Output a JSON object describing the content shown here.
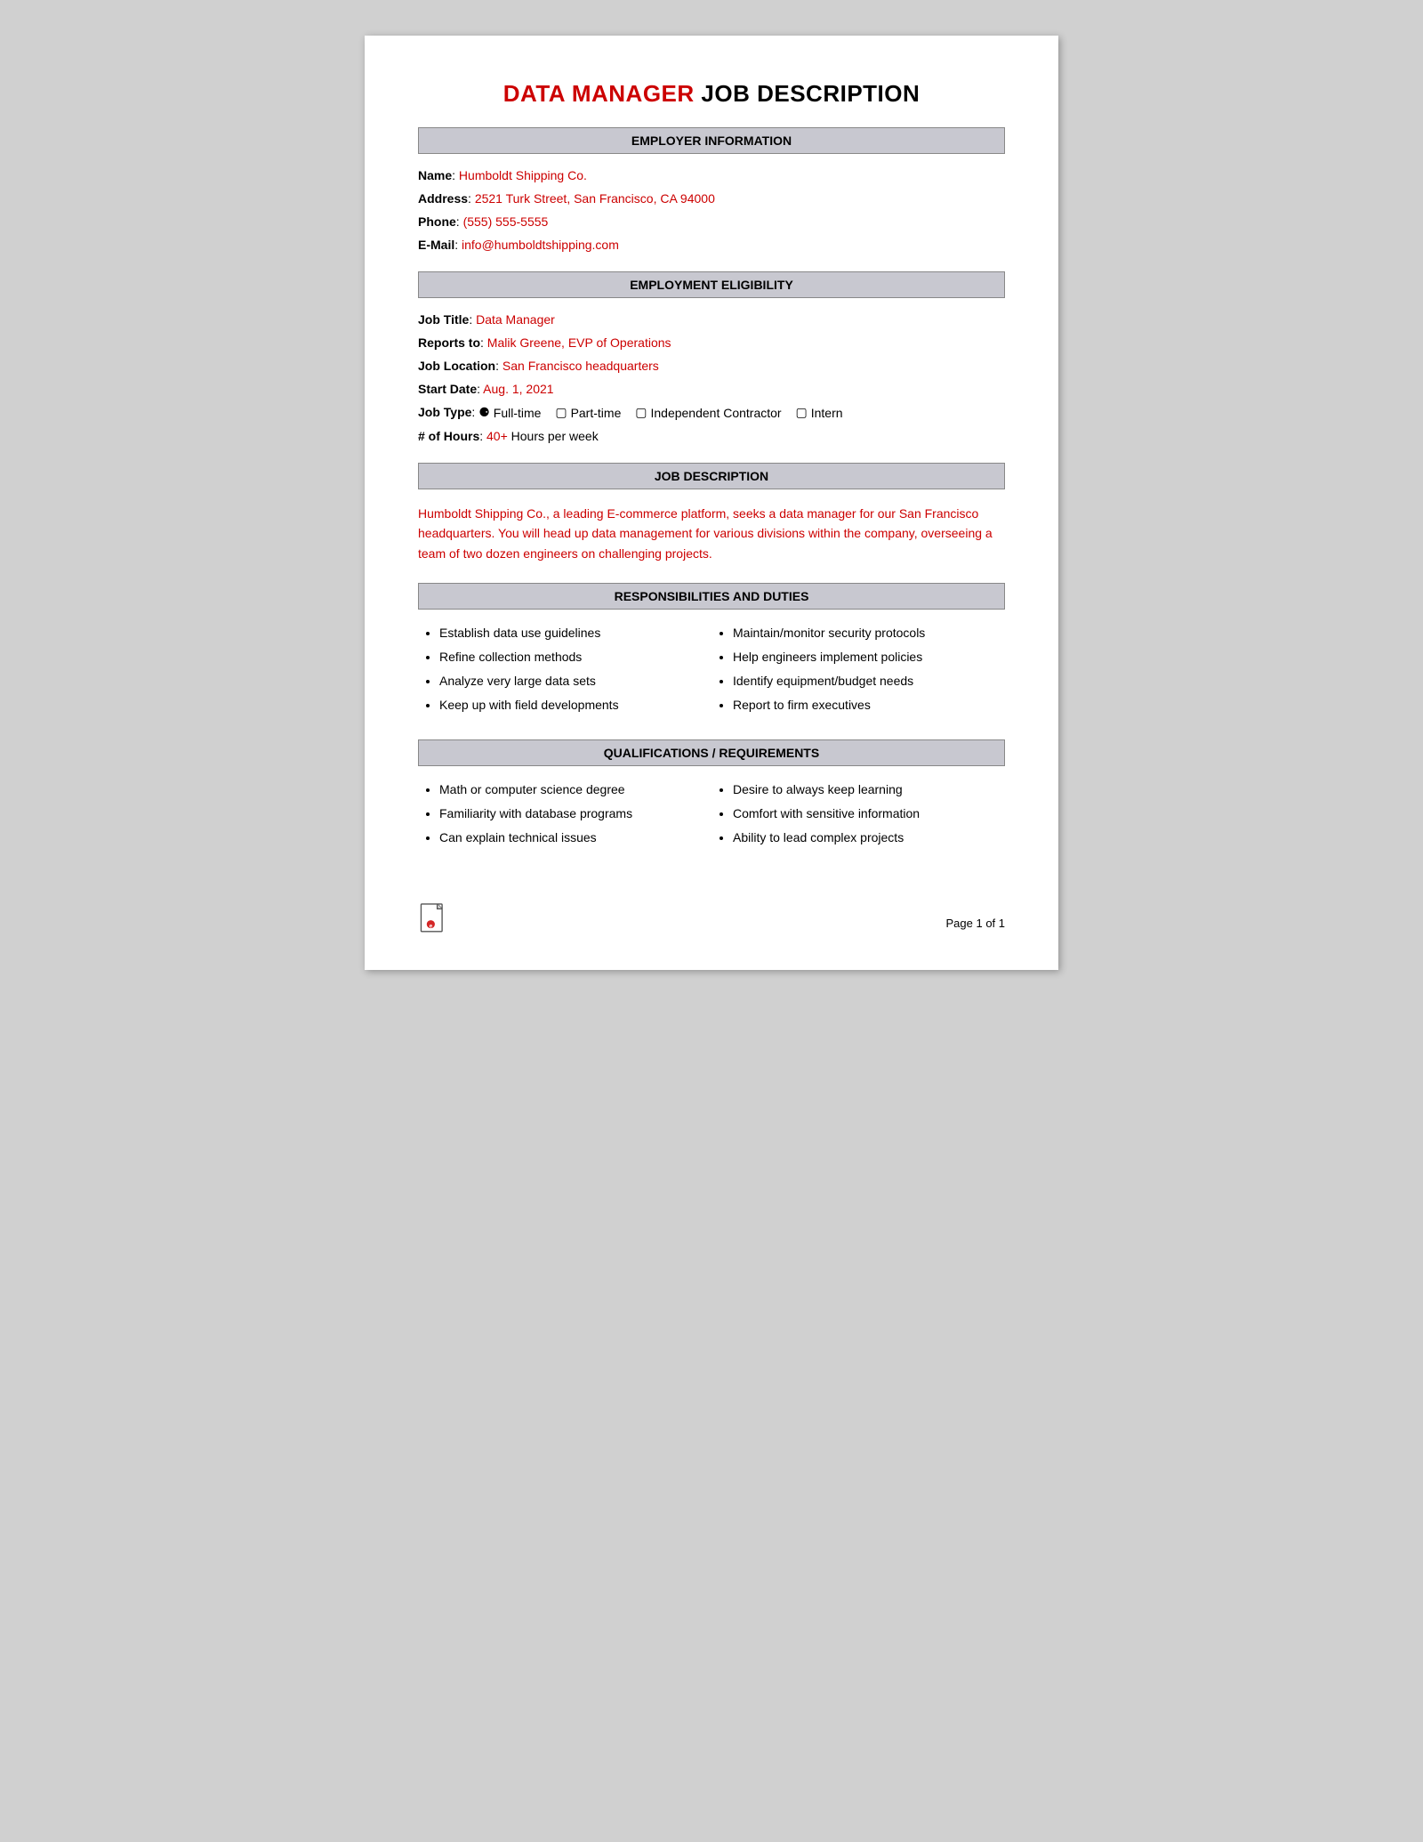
{
  "title": {
    "highlight": "DATA MANAGER",
    "rest": " JOB DESCRIPTION"
  },
  "sections": {
    "employer_info": {
      "header": "EMPLOYER INFORMATION",
      "fields": {
        "name_label": "Name",
        "name_value": "Humboldt Shipping Co.",
        "address_label": "Address",
        "address_value": "2521 Turk Street, San Francisco, CA 94000",
        "phone_label": "Phone",
        "phone_value": "(555) 555-5555",
        "email_label": "E-Mail",
        "email_value": "info@humboldtshipping.com"
      }
    },
    "employment_eligibility": {
      "header": "EMPLOYMENT ELIGIBILITY",
      "fields": {
        "job_title_label": "Job Title",
        "job_title_value": "Data Manager",
        "reports_to_label": "Reports to",
        "reports_to_value": "Malik Greene, EVP of Operations",
        "job_location_label": "Job Location",
        "job_location_value": "San Francisco headquarters",
        "start_date_label": "Start Date",
        "start_date_value": "Aug. 1, 2021",
        "job_type_label": "Job Type",
        "job_type_fulltime": "Full-time",
        "job_type_parttime": "Part-time",
        "job_type_contractor": "Independent Contractor",
        "job_type_intern": "Intern",
        "hours_label": "# of Hours",
        "hours_value": "40+",
        "hours_rest": " Hours per week"
      }
    },
    "job_description": {
      "header": "JOB DESCRIPTION",
      "text": "Humboldt Shipping Co., a leading E-commerce platform, seeks a data manager for our San Francisco headquarters. You will head up data management for various divisions within the company, overseeing a team of two dozen engineers on challenging projects."
    },
    "responsibilities": {
      "header": "RESPONSIBILITIES AND DUTIES",
      "col1": [
        "Establish data use guidelines",
        "Refine collection methods",
        "Analyze very large data sets",
        "Keep up with field developments"
      ],
      "col2": [
        "Maintain/monitor security protocols",
        "Help engineers implement policies",
        "Identify equipment/budget needs",
        "Report to firm executives"
      ]
    },
    "qualifications": {
      "header": "QUALIFICATIONS / REQUIREMENTS",
      "col1": [
        "Math or computer science degree",
        "Familiarity with database programs",
        "Can explain technical issues"
      ],
      "col2": [
        "Desire to always keep learning",
        "Comfort with sensitive information",
        "Ability to lead complex projects"
      ]
    }
  },
  "footer": {
    "page_text": "Page 1 of 1"
  }
}
